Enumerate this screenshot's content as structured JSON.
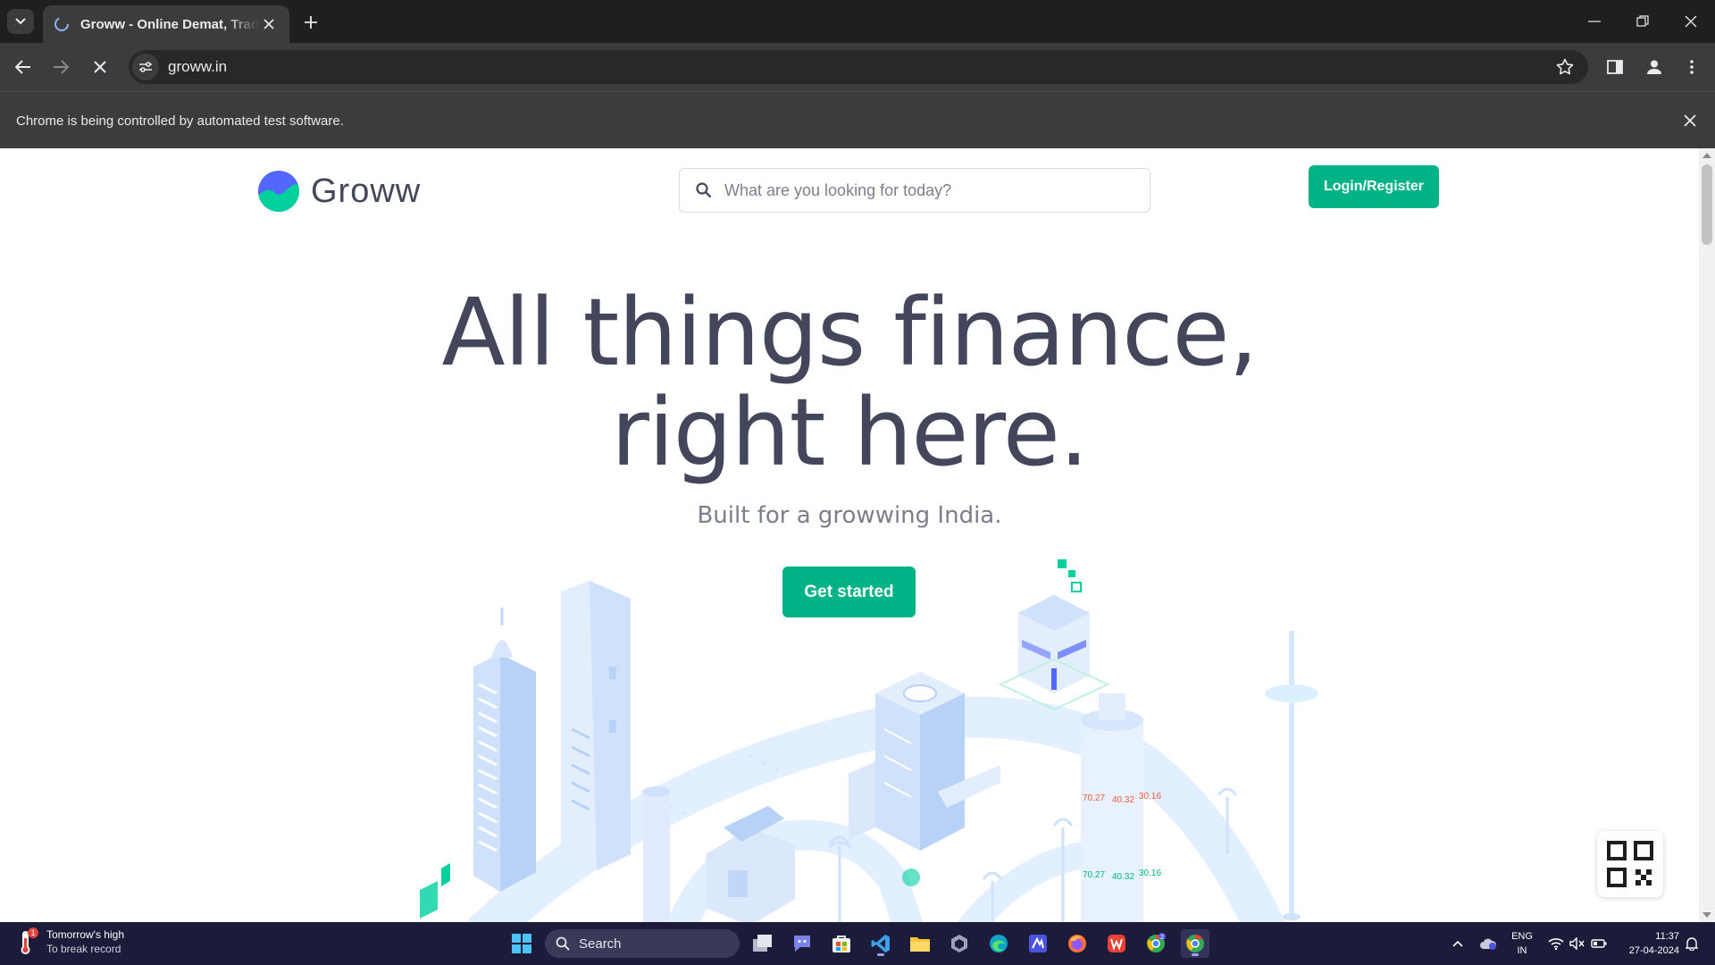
{
  "browser": {
    "tab_title": "Groww - Online Demat, Trading and Direct Mutual Fund Investment in India",
    "url": "groww.in",
    "infobar_message": "Chrome is being controlled by automated test software."
  },
  "page": {
    "brand": "Groww",
    "search_placeholder": "What are you looking for today?",
    "login_label": "Login/Register",
    "headline_line1": "All things finance,",
    "headline_line2": "right here.",
    "subheadline": "Built for a growwing India.",
    "cta_label": "Get started",
    "illustration_labels": [
      "70.27",
      "40.32",
      "30.16"
    ],
    "accent_color": "#00b386",
    "text_color": "#44475b"
  },
  "taskbar": {
    "weather_title": "Tomorrow's high",
    "weather_subtitle": "To break record",
    "search_label": "Search",
    "lang_line1": "ENG",
    "lang_line2": "IN",
    "time": "11:37",
    "date": "27-04-2024",
    "badge_count": "2"
  }
}
